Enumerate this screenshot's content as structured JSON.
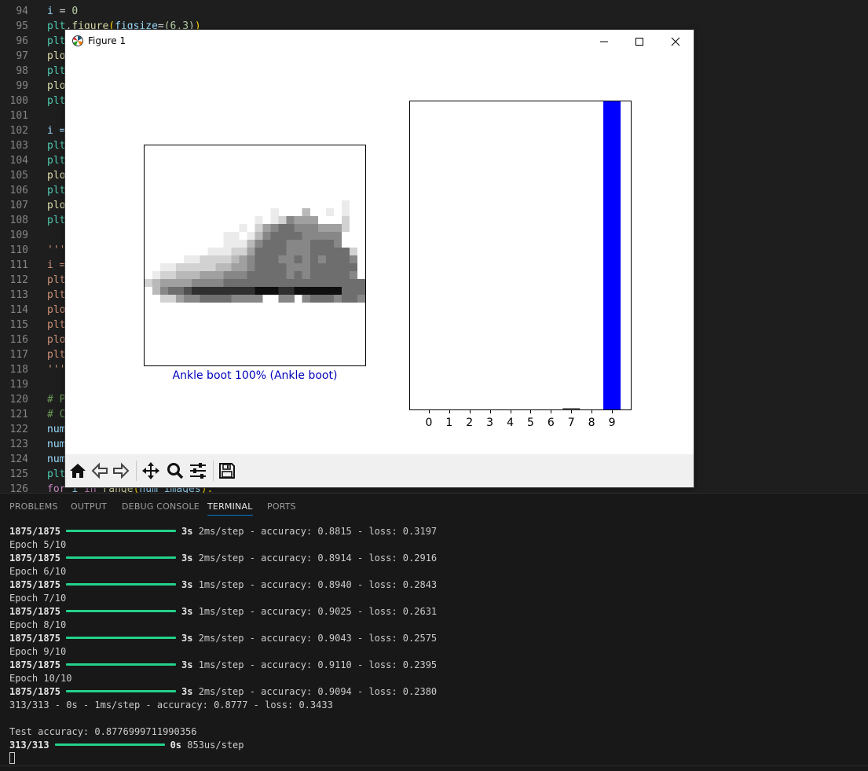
{
  "editor": {
    "lines": [
      {
        "n": "94",
        "parts": [
          [
            "i",
            "var"
          ],
          [
            " = ",
            "op"
          ],
          [
            "0",
            "num"
          ]
        ]
      },
      {
        "n": "95",
        "parts": [
          [
            "plt",
            "cls"
          ],
          [
            ".",
            "op"
          ],
          [
            "figure",
            "fn"
          ],
          [
            "(",
            "br"
          ],
          [
            "figsize",
            "var"
          ],
          [
            "=",
            "op"
          ],
          [
            "(6,3)",
            "num"
          ],
          [
            ")",
            "br"
          ]
        ]
      },
      {
        "n": "96",
        "parts": [
          [
            "plt",
            "cls"
          ]
        ]
      },
      {
        "n": "97",
        "parts": [
          [
            "plo",
            "fn"
          ]
        ]
      },
      {
        "n": "98",
        "parts": [
          [
            "plt",
            "cls"
          ]
        ]
      },
      {
        "n": "99",
        "parts": [
          [
            "plo",
            "fn"
          ]
        ]
      },
      {
        "n": "100",
        "parts": [
          [
            "plt",
            "cls"
          ]
        ]
      },
      {
        "n": "101",
        "parts": []
      },
      {
        "n": "102",
        "parts": [
          [
            "i =",
            "var"
          ]
        ]
      },
      {
        "n": "103",
        "parts": [
          [
            "plt",
            "cls"
          ]
        ]
      },
      {
        "n": "104",
        "parts": [
          [
            "plt",
            "cls"
          ]
        ]
      },
      {
        "n": "105",
        "parts": [
          [
            "plo",
            "fn"
          ]
        ]
      },
      {
        "n": "106",
        "parts": [
          [
            "plt",
            "cls"
          ]
        ]
      },
      {
        "n": "107",
        "parts": [
          [
            "plo",
            "fn"
          ]
        ]
      },
      {
        "n": "108",
        "parts": [
          [
            "plt",
            "cls"
          ]
        ]
      },
      {
        "n": "109",
        "parts": []
      },
      {
        "n": "110",
        "parts": [
          [
            "'''",
            "str"
          ]
        ]
      },
      {
        "n": "111",
        "parts": [
          [
            "i =",
            "str"
          ]
        ]
      },
      {
        "n": "112",
        "parts": [
          [
            "plt",
            "str"
          ]
        ]
      },
      {
        "n": "113",
        "parts": [
          [
            "plt",
            "str"
          ]
        ]
      },
      {
        "n": "114",
        "parts": [
          [
            "plo",
            "str"
          ]
        ]
      },
      {
        "n": "115",
        "parts": [
          [
            "plt",
            "str"
          ]
        ]
      },
      {
        "n": "116",
        "parts": [
          [
            "plo",
            "str"
          ]
        ]
      },
      {
        "n": "117",
        "parts": [
          [
            "plt",
            "str"
          ]
        ]
      },
      {
        "n": "118",
        "parts": [
          [
            "'''",
            "str"
          ]
        ]
      },
      {
        "n": "119",
        "parts": []
      },
      {
        "n": "120",
        "parts": [
          [
            "# P",
            "cm"
          ]
        ]
      },
      {
        "n": "121",
        "parts": [
          [
            "# C",
            "cm"
          ]
        ]
      },
      {
        "n": "122",
        "parts": [
          [
            "num",
            "var"
          ]
        ]
      },
      {
        "n": "123",
        "parts": [
          [
            "num",
            "var"
          ]
        ]
      },
      {
        "n": "124",
        "parts": [
          [
            "num",
            "var"
          ]
        ]
      },
      {
        "n": "125",
        "parts": [
          [
            "plt",
            "cls"
          ]
        ]
      },
      {
        "n": "126",
        "parts": [
          [
            "for ",
            "kw"
          ],
          [
            "i ",
            "var"
          ],
          [
            "in ",
            "kw"
          ],
          [
            "range",
            "fn"
          ],
          [
            "(",
            "br"
          ],
          [
            "num_images",
            "var"
          ],
          [
            "):",
            "br"
          ]
        ]
      }
    ]
  },
  "figure_window": {
    "title": "Figure 1",
    "image_caption": "Ankle boot 100% (Ankle boot)",
    "caption_color": "#0000bb",
    "image_rows": [
      "............................",
      "............................",
      "............................",
      "............................",
      "............................",
      "............................",
      "............................",
      ".........................1..",
      "................1...3..1.1..",
      "..............1.125444...2..",
      "............1.245665554442..",
      "..........11.135666655555...",
      "..........111356665556665...",
      "........1112246666555666662.",
      ".....1122223456665565656665.",
      "..1122222334456666555666666.",
      ".12233344455566666565666665.",
      "2344445555666666666666666666",
      ".356678888888899988999999666",
      "..2245566665555..55.56665665",
      "............................",
      "............................",
      "............................",
      "............................",
      "............................",
      "............................",
      "............................",
      "............................"
    ],
    "chart_data": {
      "type": "bar",
      "categories": [
        "0",
        "1",
        "2",
        "3",
        "4",
        "5",
        "6",
        "7",
        "8",
        "9"
      ],
      "values": [
        0,
        0,
        0,
        0,
        0,
        0,
        0,
        0.005,
        0,
        1.0
      ],
      "highlight_index": 9,
      "bar_color": "#0000ff",
      "other_color": "#777777",
      "ylim": [
        0,
        1
      ],
      "title": "",
      "xlabel": "",
      "ylabel": ""
    },
    "toolbar_icons": [
      "home-icon",
      "back-arrow-icon",
      "forward-arrow-icon",
      "pan-icon",
      "zoom-icon",
      "configure-subplots-icon",
      "save-icon"
    ]
  },
  "panel": {
    "tabs": [
      "PROBLEMS",
      "OUTPUT",
      "DEBUG CONSOLE",
      "TERMINAL",
      "PORTS"
    ],
    "active_tab": "TERMINAL",
    "terminal_lines": [
      {
        "kind": "step",
        "steps": "1875/1875",
        "time": "3s",
        "rest": "2ms/step - accuracy: 0.8815 - loss: 0.3197"
      },
      {
        "kind": "text",
        "text": "Epoch 5/10"
      },
      {
        "kind": "step",
        "steps": "1875/1875",
        "time": "3s",
        "rest": "2ms/step - accuracy: 0.8914 - loss: 0.2916"
      },
      {
        "kind": "text",
        "text": "Epoch 6/10"
      },
      {
        "kind": "step",
        "steps": "1875/1875",
        "time": "3s",
        "rest": "1ms/step - accuracy: 0.8940 - loss: 0.2843"
      },
      {
        "kind": "text",
        "text": "Epoch 7/10"
      },
      {
        "kind": "step",
        "steps": "1875/1875",
        "time": "3s",
        "rest": "1ms/step - accuracy: 0.9025 - loss: 0.2631"
      },
      {
        "kind": "text",
        "text": "Epoch 8/10"
      },
      {
        "kind": "step",
        "steps": "1875/1875",
        "time": "3s",
        "rest": "2ms/step - accuracy: 0.9043 - loss: 0.2575"
      },
      {
        "kind": "text",
        "text": "Epoch 9/10"
      },
      {
        "kind": "step",
        "steps": "1875/1875",
        "time": "3s",
        "rest": "1ms/step - accuracy: 0.9110 - loss: 0.2395"
      },
      {
        "kind": "text",
        "text": "Epoch 10/10"
      },
      {
        "kind": "step",
        "steps": "1875/1875",
        "time": "3s",
        "rest": "2ms/step - accuracy: 0.9094 - loss: 0.2380"
      },
      {
        "kind": "text",
        "text": "313/313 - 0s - 1ms/step - accuracy: 0.8777 - loss: 0.3433"
      },
      {
        "kind": "text",
        "text": ""
      },
      {
        "kind": "text",
        "text": "Test accuracy: 0.8776999711990356"
      },
      {
        "kind": "step-short",
        "steps": "313/313",
        "time": "0s",
        "rest": "853us/step"
      }
    ],
    "progress_color": "#23d18b"
  }
}
